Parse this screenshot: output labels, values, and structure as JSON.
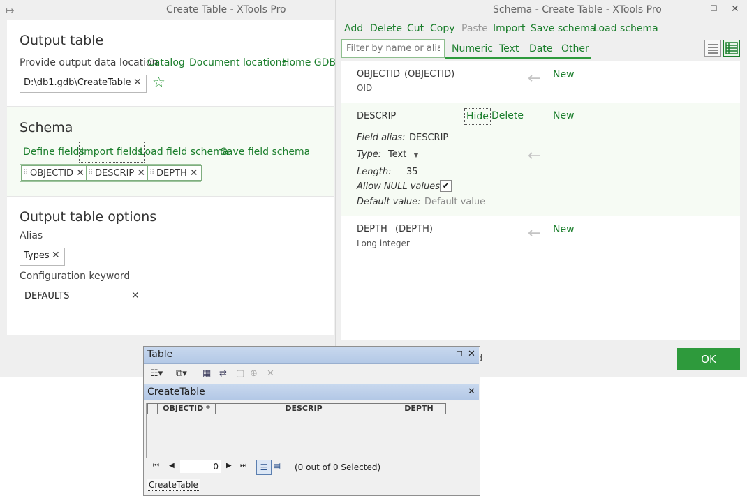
{
  "left_window": {
    "title": "Create Table - XTools Pro",
    "output_table": {
      "heading": "Output table",
      "location_label": "Provide output data location",
      "links": [
        "Catalog",
        "Document locations",
        "Home GDB"
      ],
      "path_value": "D:\\db1.gdb\\CreateTable"
    },
    "schema": {
      "heading": "Schema",
      "actions": [
        "Define fields",
        "Import fields",
        "Load field schema",
        "Save field schema"
      ],
      "fields": [
        "OBJECTID",
        "DESCRIP",
        "DEPTH"
      ]
    },
    "options": {
      "heading": "Output table options",
      "alias_label": "Alias",
      "alias_value": "Types",
      "config_label": "Configuration keyword",
      "config_value": "DEFAULTS"
    }
  },
  "right_window": {
    "title": "Schema - Create Table - XTools Pro",
    "toolbar": [
      "Add",
      "Delete",
      "Cut",
      "Copy",
      "Paste",
      "Import",
      "Save schema",
      "Load schema"
    ],
    "filter_placeholder": "Filter by name or alias",
    "filter_tabs": [
      "Numeric",
      "Text",
      "Date",
      "Other"
    ],
    "ok_label": "OK",
    "behind_fragment": "d",
    "fields": [
      {
        "name": "OBJECTID",
        "alias": "(OBJECTID)",
        "type": "OID",
        "status": "New"
      },
      {
        "name": "DESCRIP",
        "status": "New",
        "hide_label": "Hide",
        "delete_label": "Delete",
        "alias_label": "Field alias:",
        "alias_value": "DESCRIP",
        "type_label": "Type:",
        "type_value": "Text",
        "length_label": "Length:",
        "length_value": "35",
        "null_label": "Allow NULL values:",
        "default_label": "Default value:",
        "default_placeholder": "Default value"
      },
      {
        "name": "DEPTH",
        "alias": "(DEPTH)",
        "type": "Long integer",
        "status": "New"
      }
    ]
  },
  "table_window": {
    "title": "Table",
    "table_name": "CreateTable",
    "columns": [
      "OBJECTID *",
      "DESCRIP",
      "DEPTH"
    ],
    "record_value": "0",
    "selection_status": "(0 out of 0 Selected)",
    "bottom_tab": "CreateTable"
  },
  "colors": {
    "accent": "#1b7e2c",
    "ok_button": "#2e9a3c",
    "table_bar": "#b9cde8"
  }
}
